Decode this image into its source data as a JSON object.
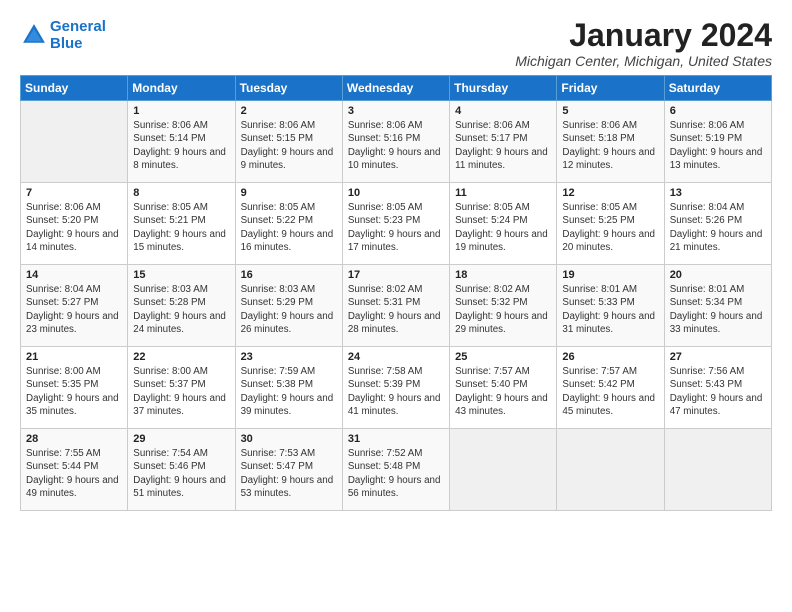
{
  "header": {
    "logo_text_general": "General",
    "logo_text_blue": "Blue",
    "month_title": "January 2024",
    "location": "Michigan Center, Michigan, United States"
  },
  "days_of_week": [
    "Sunday",
    "Monday",
    "Tuesday",
    "Wednesday",
    "Thursday",
    "Friday",
    "Saturday"
  ],
  "weeks": [
    [
      {
        "day": "",
        "sunrise": "",
        "sunset": "",
        "daylight": "",
        "empty": true
      },
      {
        "day": "1",
        "sunrise": "Sunrise: 8:06 AM",
        "sunset": "Sunset: 5:14 PM",
        "daylight": "Daylight: 9 hours and 8 minutes."
      },
      {
        "day": "2",
        "sunrise": "Sunrise: 8:06 AM",
        "sunset": "Sunset: 5:15 PM",
        "daylight": "Daylight: 9 hours and 9 minutes."
      },
      {
        "day": "3",
        "sunrise": "Sunrise: 8:06 AM",
        "sunset": "Sunset: 5:16 PM",
        "daylight": "Daylight: 9 hours and 10 minutes."
      },
      {
        "day": "4",
        "sunrise": "Sunrise: 8:06 AM",
        "sunset": "Sunset: 5:17 PM",
        "daylight": "Daylight: 9 hours and 11 minutes."
      },
      {
        "day": "5",
        "sunrise": "Sunrise: 8:06 AM",
        "sunset": "Sunset: 5:18 PM",
        "daylight": "Daylight: 9 hours and 12 minutes."
      },
      {
        "day": "6",
        "sunrise": "Sunrise: 8:06 AM",
        "sunset": "Sunset: 5:19 PM",
        "daylight": "Daylight: 9 hours and 13 minutes."
      }
    ],
    [
      {
        "day": "7",
        "sunrise": "Sunrise: 8:06 AM",
        "sunset": "Sunset: 5:20 PM",
        "daylight": "Daylight: 9 hours and 14 minutes."
      },
      {
        "day": "8",
        "sunrise": "Sunrise: 8:05 AM",
        "sunset": "Sunset: 5:21 PM",
        "daylight": "Daylight: 9 hours and 15 minutes."
      },
      {
        "day": "9",
        "sunrise": "Sunrise: 8:05 AM",
        "sunset": "Sunset: 5:22 PM",
        "daylight": "Daylight: 9 hours and 16 minutes."
      },
      {
        "day": "10",
        "sunrise": "Sunrise: 8:05 AM",
        "sunset": "Sunset: 5:23 PM",
        "daylight": "Daylight: 9 hours and 17 minutes."
      },
      {
        "day": "11",
        "sunrise": "Sunrise: 8:05 AM",
        "sunset": "Sunset: 5:24 PM",
        "daylight": "Daylight: 9 hours and 19 minutes."
      },
      {
        "day": "12",
        "sunrise": "Sunrise: 8:05 AM",
        "sunset": "Sunset: 5:25 PM",
        "daylight": "Daylight: 9 hours and 20 minutes."
      },
      {
        "day": "13",
        "sunrise": "Sunrise: 8:04 AM",
        "sunset": "Sunset: 5:26 PM",
        "daylight": "Daylight: 9 hours and 21 minutes."
      }
    ],
    [
      {
        "day": "14",
        "sunrise": "Sunrise: 8:04 AM",
        "sunset": "Sunset: 5:27 PM",
        "daylight": "Daylight: 9 hours and 23 minutes."
      },
      {
        "day": "15",
        "sunrise": "Sunrise: 8:03 AM",
        "sunset": "Sunset: 5:28 PM",
        "daylight": "Daylight: 9 hours and 24 minutes."
      },
      {
        "day": "16",
        "sunrise": "Sunrise: 8:03 AM",
        "sunset": "Sunset: 5:29 PM",
        "daylight": "Daylight: 9 hours and 26 minutes."
      },
      {
        "day": "17",
        "sunrise": "Sunrise: 8:02 AM",
        "sunset": "Sunset: 5:31 PM",
        "daylight": "Daylight: 9 hours and 28 minutes."
      },
      {
        "day": "18",
        "sunrise": "Sunrise: 8:02 AM",
        "sunset": "Sunset: 5:32 PM",
        "daylight": "Daylight: 9 hours and 29 minutes."
      },
      {
        "day": "19",
        "sunrise": "Sunrise: 8:01 AM",
        "sunset": "Sunset: 5:33 PM",
        "daylight": "Daylight: 9 hours and 31 minutes."
      },
      {
        "day": "20",
        "sunrise": "Sunrise: 8:01 AM",
        "sunset": "Sunset: 5:34 PM",
        "daylight": "Daylight: 9 hours and 33 minutes."
      }
    ],
    [
      {
        "day": "21",
        "sunrise": "Sunrise: 8:00 AM",
        "sunset": "Sunset: 5:35 PM",
        "daylight": "Daylight: 9 hours and 35 minutes."
      },
      {
        "day": "22",
        "sunrise": "Sunrise: 8:00 AM",
        "sunset": "Sunset: 5:37 PM",
        "daylight": "Daylight: 9 hours and 37 minutes."
      },
      {
        "day": "23",
        "sunrise": "Sunrise: 7:59 AM",
        "sunset": "Sunset: 5:38 PM",
        "daylight": "Daylight: 9 hours and 39 minutes."
      },
      {
        "day": "24",
        "sunrise": "Sunrise: 7:58 AM",
        "sunset": "Sunset: 5:39 PM",
        "daylight": "Daylight: 9 hours and 41 minutes."
      },
      {
        "day": "25",
        "sunrise": "Sunrise: 7:57 AM",
        "sunset": "Sunset: 5:40 PM",
        "daylight": "Daylight: 9 hours and 43 minutes."
      },
      {
        "day": "26",
        "sunrise": "Sunrise: 7:57 AM",
        "sunset": "Sunset: 5:42 PM",
        "daylight": "Daylight: 9 hours and 45 minutes."
      },
      {
        "day": "27",
        "sunrise": "Sunrise: 7:56 AM",
        "sunset": "Sunset: 5:43 PM",
        "daylight": "Daylight: 9 hours and 47 minutes."
      }
    ],
    [
      {
        "day": "28",
        "sunrise": "Sunrise: 7:55 AM",
        "sunset": "Sunset: 5:44 PM",
        "daylight": "Daylight: 9 hours and 49 minutes."
      },
      {
        "day": "29",
        "sunrise": "Sunrise: 7:54 AM",
        "sunset": "Sunset: 5:46 PM",
        "daylight": "Daylight: 9 hours and 51 minutes."
      },
      {
        "day": "30",
        "sunrise": "Sunrise: 7:53 AM",
        "sunset": "Sunset: 5:47 PM",
        "daylight": "Daylight: 9 hours and 53 minutes."
      },
      {
        "day": "31",
        "sunrise": "Sunrise: 7:52 AM",
        "sunset": "Sunset: 5:48 PM",
        "daylight": "Daylight: 9 hours and 56 minutes."
      },
      {
        "day": "",
        "sunrise": "",
        "sunset": "",
        "daylight": "",
        "empty": true
      },
      {
        "day": "",
        "sunrise": "",
        "sunset": "",
        "daylight": "",
        "empty": true
      },
      {
        "day": "",
        "sunrise": "",
        "sunset": "",
        "daylight": "",
        "empty": true
      }
    ]
  ]
}
